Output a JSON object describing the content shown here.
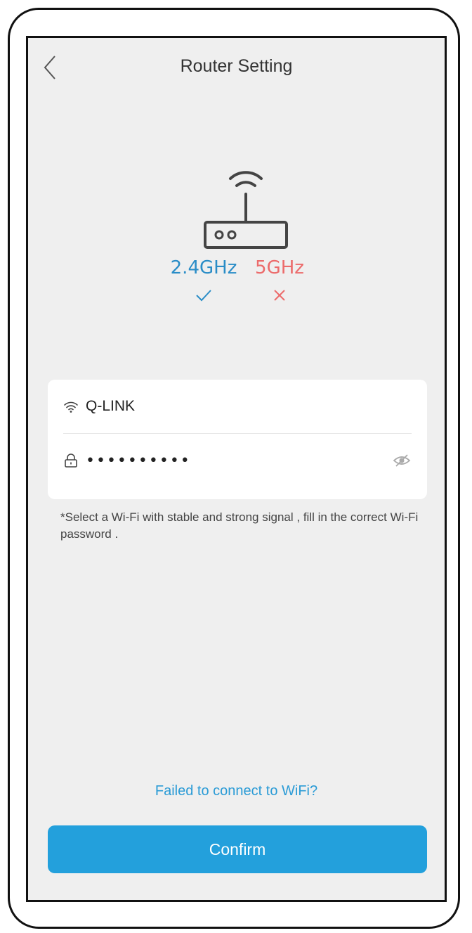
{
  "header": {
    "title": "Router Setting"
  },
  "bands": {
    "ghz24": {
      "label": "2.4GHz",
      "supported": true
    },
    "ghz5": {
      "label": "5GHz",
      "supported": false
    }
  },
  "wifi": {
    "ssid": "Q-LINK",
    "password_masked": "••••••••••"
  },
  "hint": "*Select a Wi-Fi with stable and strong signal , fill in the correct Wi-Fi password .",
  "failed_link": "Failed to connect to WiFi?",
  "confirm_label": "Confirm",
  "colors": {
    "accent": "#23a0dc",
    "band24": "#2a8dc7",
    "band5": "#ec6b6b",
    "background": "#efefef"
  }
}
